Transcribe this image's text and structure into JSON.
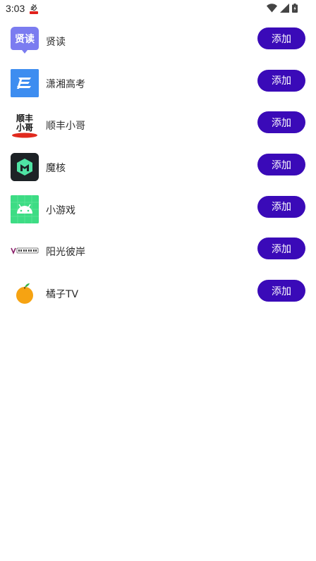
{
  "status_bar": {
    "time": "3:03",
    "icons": [
      "app-notification-icon",
      "wifi-icon",
      "signal-icon",
      "battery-icon"
    ]
  },
  "apps": [
    {
      "name": "贤读",
      "button": "添加",
      "icon": "xiandu-logo"
    },
    {
      "name": "潇湘高考",
      "button": "添加",
      "icon": "xiaoxiang-logo"
    },
    {
      "name": "顺丰小哥",
      "button": "添加",
      "icon": "shunfeng-logo"
    },
    {
      "name": "魔核",
      "button": "添加",
      "icon": "mohe-logo"
    },
    {
      "name": "小游戏",
      "button": "添加",
      "icon": "android-logo"
    },
    {
      "name": "阳光彼岸",
      "button": "添加",
      "icon": "yangguang-logo"
    },
    {
      "name": "橘子TV",
      "button": "添加",
      "icon": "orange-logo"
    }
  ],
  "colors": {
    "button_bg": "#3a0ab8",
    "button_text": "#ffffff"
  }
}
